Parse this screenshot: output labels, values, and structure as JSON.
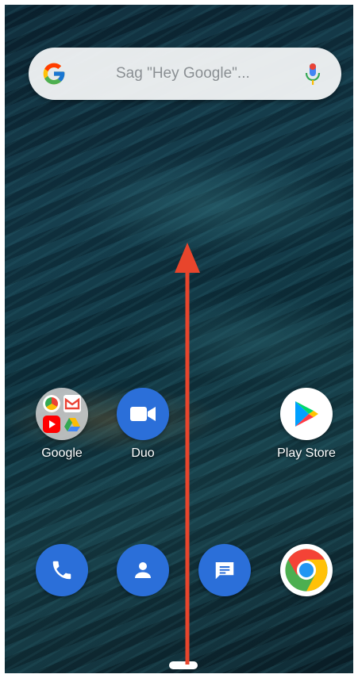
{
  "search": {
    "placeholder": "Sag \"Hey Google\"...",
    "logo_icon": "google-g-icon",
    "mic_icon": "microphone-icon"
  },
  "apps_row": [
    {
      "label": "Google",
      "icon": "google-folder-icon"
    },
    {
      "label": "Duo",
      "icon": "video-camera-icon"
    },
    {
      "label": "Play Store",
      "icon": "play-store-icon"
    }
  ],
  "dock": [
    {
      "icon": "phone-icon"
    },
    {
      "icon": "contacts-icon"
    },
    {
      "icon": "messages-icon"
    },
    {
      "icon": "chrome-icon"
    }
  ],
  "annotation": {
    "arrow_color": "#e8452c",
    "direction": "up"
  },
  "colors": {
    "accent_blue": "#2b6fd9",
    "white": "#ffffff"
  }
}
